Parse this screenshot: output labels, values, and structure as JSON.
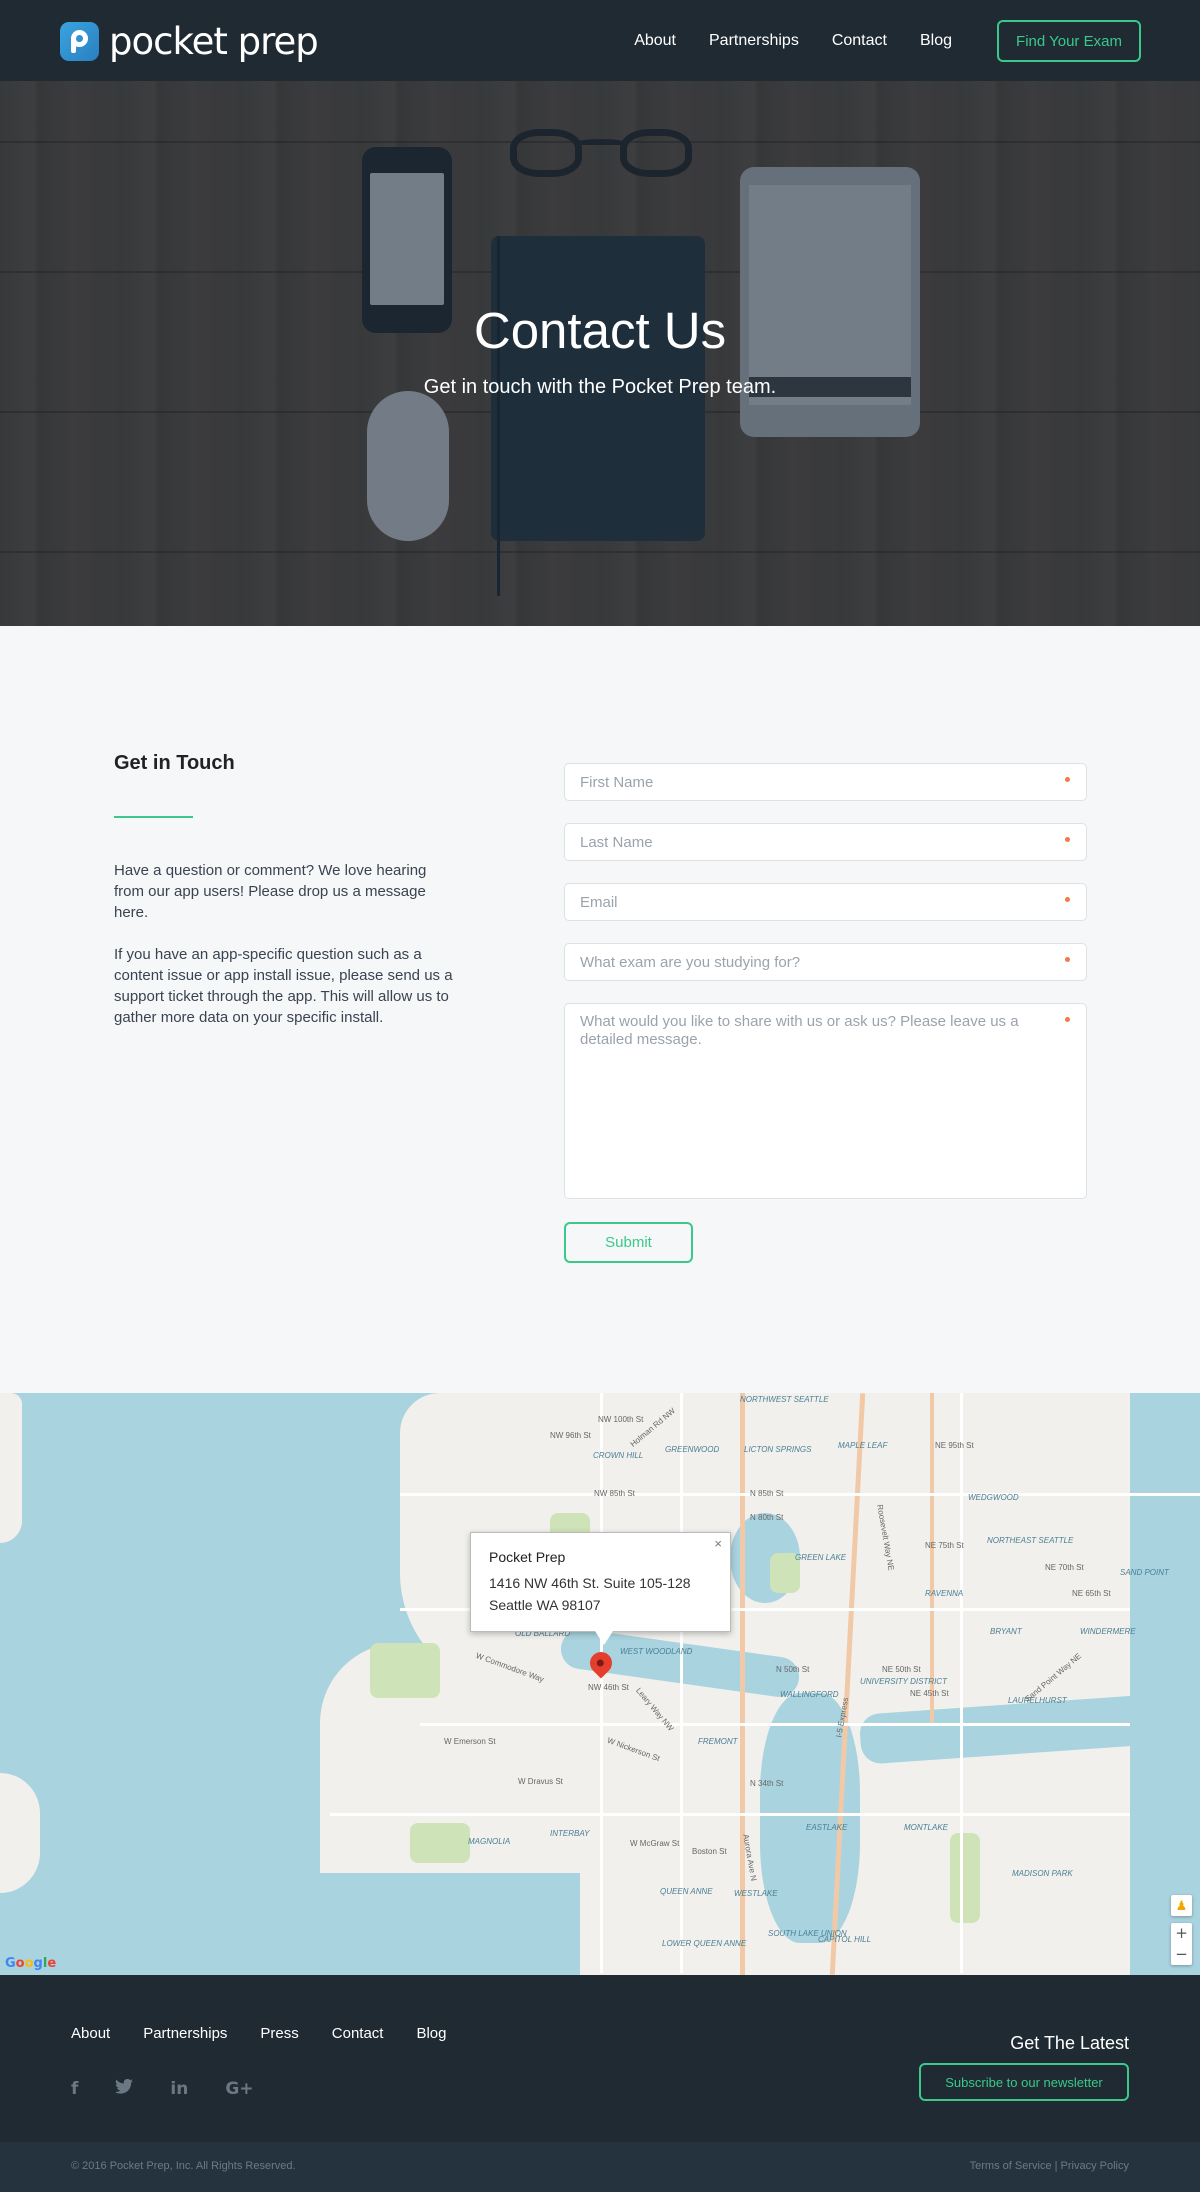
{
  "brand": {
    "name": "pocket prep"
  },
  "nav": {
    "items": [
      "About",
      "Partnerships",
      "Contact",
      "Blog"
    ],
    "cta": "Find Your Exam"
  },
  "hero": {
    "title": "Contact Us",
    "subtitle": "Get in touch with the Pocket Prep team."
  },
  "contact": {
    "heading": "Get in Touch",
    "paragraphs": [
      "Have a question or comment? We love hearing from our app users! Please drop us a message here.",
      "If you have an app-specific question such as a content issue or app install issue, please send us a support ticket through the app. This will allow us to gather more data on your specific install."
    ],
    "form": {
      "first_name_placeholder": "First Name",
      "last_name_placeholder": "Last Name",
      "email_placeholder": "Email",
      "exam_placeholder": "What exam are you studying for?",
      "message_placeholder": "What would you like to share with us or ask us? Please leave us a detailed message.",
      "submit_label": "Submit"
    },
    "colors": {
      "accent": "#3ac98a",
      "required_dot": "#f07a4a"
    }
  },
  "map": {
    "info": {
      "name": "Pocket Prep",
      "address_line1": "1416 NW 46th St. Suite 105-128",
      "address_line2": "Seattle WA 98107",
      "close_glyph": "×"
    },
    "neighborhoods": [
      "NORTHWEST SEATTLE",
      "GREENWOOD",
      "LICTON SPRINGS",
      "MAPLE LEAF",
      "WEDGWOOD",
      "CROWN HILL",
      "GREEN LAKE",
      "NORTHEAST SEATTLE",
      "SAND POINT",
      "RAVENNA",
      "BRYANT",
      "WINDERMERE",
      "OLD BALLARD",
      "WEST WOODLAND",
      "WALLINGFORD",
      "UNIVERSITY DISTRICT",
      "LAURELHURST",
      "FREMONT",
      "EASTLAKE",
      "MONTLAKE",
      "MAGNOLIA",
      "INTERBAY",
      "QUEEN ANNE",
      "WESTLAKE",
      "MADISON PARK",
      "SOUTH LAKE UNION",
      "CAPITOL HILL",
      "LOWER QUEEN ANNE"
    ],
    "streets": [
      "NW 100th St",
      "NW 96th St",
      "Holman Rd NW",
      "NW 85th St",
      "N 85th St",
      "N 80th St",
      "NE 95th St",
      "NE 75th St",
      "NE 70th St",
      "NE 65th St",
      "N 50th St",
      "NE 50th St",
      "NE 45th St",
      "NW 46th St",
      "W Commodore Way",
      "W Emerson St",
      "W Dravus St",
      "N 34th St",
      "W Nickerson St",
      "W McGraw St",
      "Boston St",
      "I-5 Express",
      "Aurora Ave N",
      "Roosevelt Way NE",
      "Sand Point Way NE",
      "Leary Way NW"
    ],
    "controls": {
      "pegman": "♟",
      "zoom_in": "+",
      "zoom_out": "−",
      "attribution": "Google"
    }
  },
  "footer": {
    "nav": [
      "About",
      "Partnerships",
      "Press",
      "Contact",
      "Blog"
    ],
    "socials": [
      "f",
      "t",
      "in",
      "G+"
    ],
    "social_icons": [
      "facebook-icon",
      "twitter-icon",
      "linkedin-icon",
      "google-plus-icon"
    ],
    "latest_heading": "Get The Latest",
    "newsletter_label": "Subscribe to our newsletter",
    "copyright": "© 2016 Pocket Prep, Inc. All Rights Reserved.",
    "legal": "Terms of Service | Privacy Policy"
  }
}
